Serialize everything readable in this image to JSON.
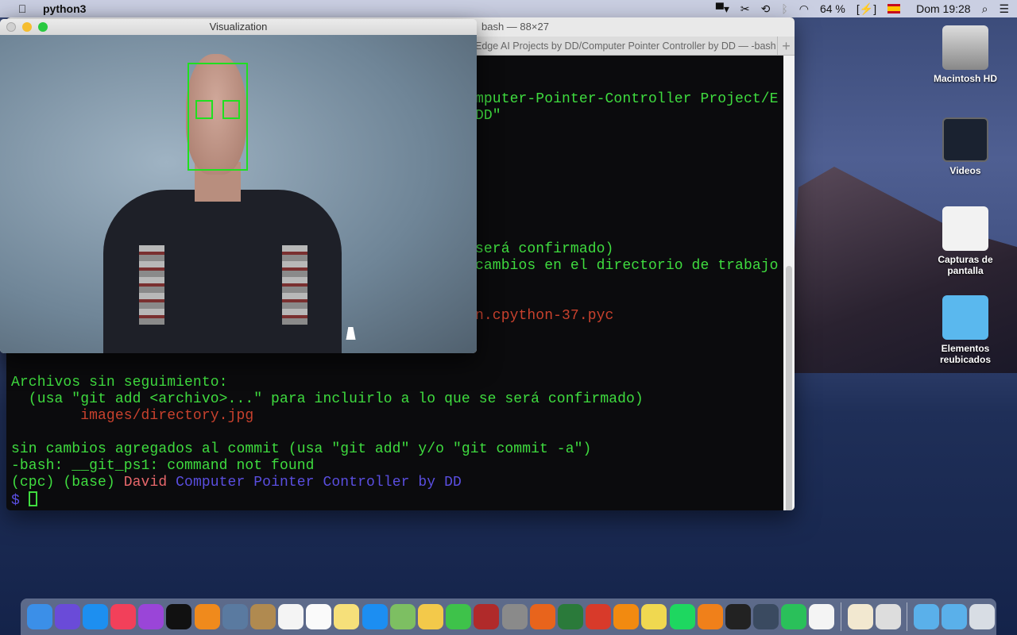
{
  "menubar": {
    "app_name": "python3",
    "battery": "64 %",
    "clock": "Dom 19:28",
    "icons": [
      "apple-icon",
      "display-icon",
      "scissors-icon",
      "time-machine-icon",
      "bluetooth-icon",
      "wifi-icon",
      "battery-charging-icon",
      "spain-flag-input-icon",
      "spotlight-search-icon",
      "notification-center-icon"
    ]
  },
  "terminal": {
    "window_title": "bash — 88×27",
    "tab_label": "Edge AI Projects by DD/Computer Pointer Controller by DD — -bash",
    "lines_partial": [
      "mputer-Pointer-Controller Project/E",
      "DD\"",
      "será confirmado)",
      "cambios en el directorio de trabajo",
      "n.cpython-37.pyc"
    ],
    "lines": [
      "Archivos sin seguimiento:",
      "  (usa \"git add <archivo>...\" para incluirlo a lo que se será confirmado)",
      "        images/directory.jpg",
      "sin cambios agregados al commit (usa \"git add\" y/o \"git commit -a\")",
      "-bash: __git_ps1: command not found"
    ],
    "prompt": {
      "env": "(cpc) (base) ",
      "user": "David",
      "dir": " Computer Pointer Controller by DD",
      "symbol": "$ "
    },
    "colors": {
      "text": "#3fdc3f",
      "untracked": "#c8412d",
      "user": "#e8676b",
      "dir": "#5a4ee0"
    }
  },
  "visualization": {
    "title": "Visualization"
  },
  "desktop": {
    "icons": [
      {
        "label": "Macintosh HD"
      },
      {
        "label": "Videos"
      },
      {
        "label": "Capturas de pantalla"
      },
      {
        "label": "Elementos reubicados"
      }
    ]
  },
  "dock": {
    "apps": [
      {
        "name": "finder",
        "color": "#3b8fe8"
      },
      {
        "name": "siri",
        "color": "#6a4bd8"
      },
      {
        "name": "safari",
        "color": "#1d8ff0"
      },
      {
        "name": "music",
        "color": "#f2405a"
      },
      {
        "name": "podcasts",
        "color": "#9a45d8"
      },
      {
        "name": "apple-tv",
        "color": "#111"
      },
      {
        "name": "books",
        "color": "#f08a1c"
      },
      {
        "name": "preview",
        "color": "#5a7aa0"
      },
      {
        "name": "contacts",
        "color": "#b08a50"
      },
      {
        "name": "calendar",
        "color": "#f4f4f4"
      },
      {
        "name": "reminders",
        "color": "#fafafa"
      },
      {
        "name": "notes",
        "color": "#f6e07a"
      },
      {
        "name": "app-store",
        "color": "#1c8ef2"
      },
      {
        "name": "maps",
        "color": "#7dbf62"
      },
      {
        "name": "photos",
        "color": "#f3c94a"
      },
      {
        "name": "facetime",
        "color": "#3ec24a"
      },
      {
        "name": "photo-booth",
        "color": "#b02a2a"
      },
      {
        "name": "system-preferences",
        "color": "#8a8a8a"
      },
      {
        "name": "firefox",
        "color": "#e8641c"
      },
      {
        "name": "world-app",
        "color": "#2a7a3a"
      },
      {
        "name": "popcorn",
        "color": "#d83a2a"
      },
      {
        "name": "vlc",
        "color": "#f28a10"
      },
      {
        "name": "stickies",
        "color": "#f0d850"
      },
      {
        "name": "spotify",
        "color": "#1ed760"
      },
      {
        "name": "sublime-text",
        "color": "#f0801a"
      },
      {
        "name": "terminal",
        "color": "#222"
      },
      {
        "name": "activity-monitor",
        "color": "#3a4a60"
      },
      {
        "name": "whatsapp",
        "color": "#2ac05a"
      },
      {
        "name": "document",
        "color": "#f4f4f4"
      },
      {
        "name": "installer",
        "color": "#f2e8d0"
      },
      {
        "name": "archive",
        "color": "#ddd"
      },
      {
        "name": "applications-folder",
        "color": "#5ab0ea"
      },
      {
        "name": "downloads-folder",
        "color": "#5ab0ea"
      },
      {
        "name": "trash",
        "color": "#d8dde4"
      }
    ]
  }
}
